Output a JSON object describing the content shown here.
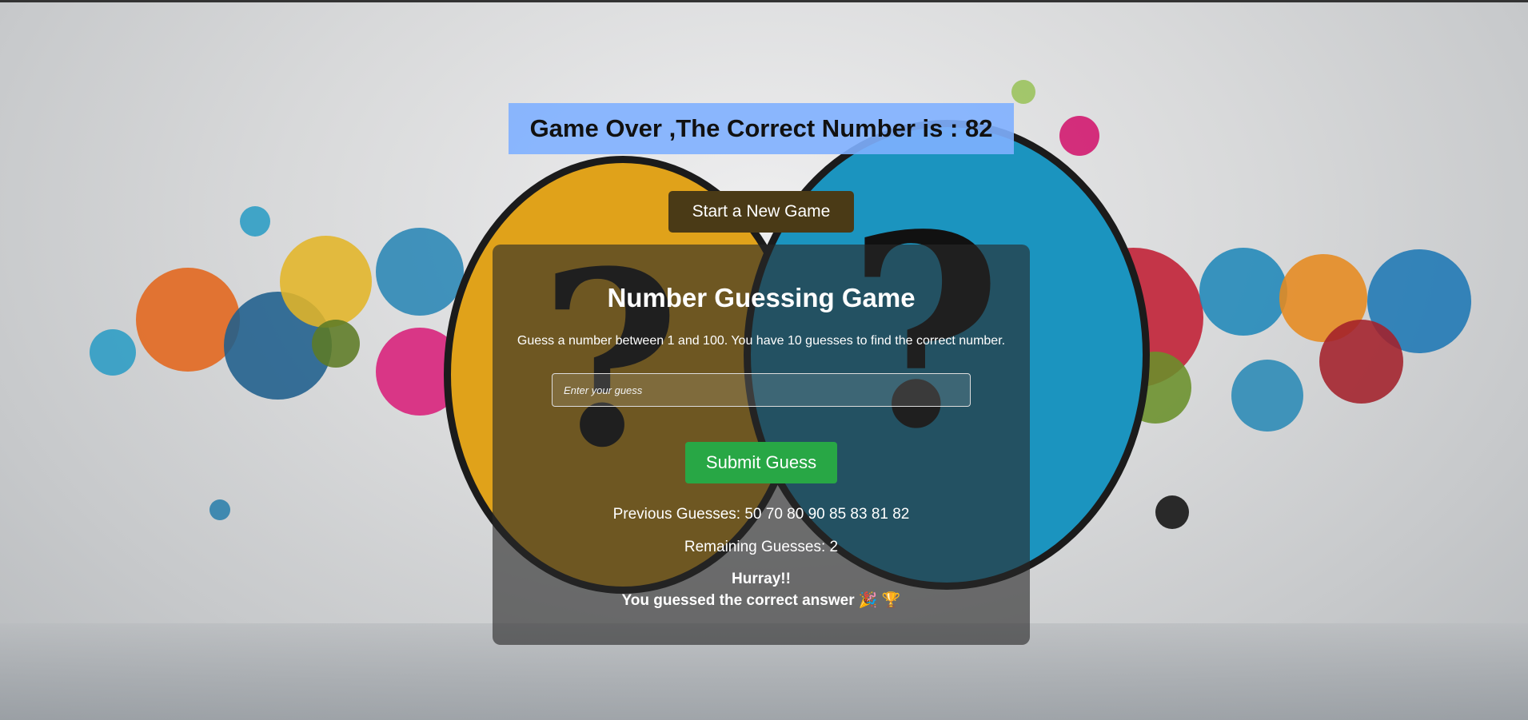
{
  "banner": {
    "text": "Game Over ,The Correct Number is : 82"
  },
  "new_game_button": {
    "label": "Start a New Game"
  },
  "game": {
    "title": "Number Guessing Game",
    "instructions": "Guess a number between 1 and 100. You have 10 guesses to find the correct number.",
    "input_placeholder": "Enter your guess",
    "input_value": "",
    "submit_label": "Submit Guess",
    "previous_guesses_text": "Previous Guesses: 50 70 80 90 85 83 81 82",
    "remaining_text": "Remaining Guesses: 2",
    "hurray_text": "Hurray!!",
    "success_text": "You guessed the correct answer 🎉 🏆"
  },
  "colors": {
    "banner_bg": "#80b0ff",
    "new_game_button_bg": "#4a3a16",
    "submit_button_bg": "#28a745",
    "card_bg": "rgba(40,40,40,0.62)"
  },
  "background": {
    "icon": "question-mark-speech-bubbles-image"
  }
}
